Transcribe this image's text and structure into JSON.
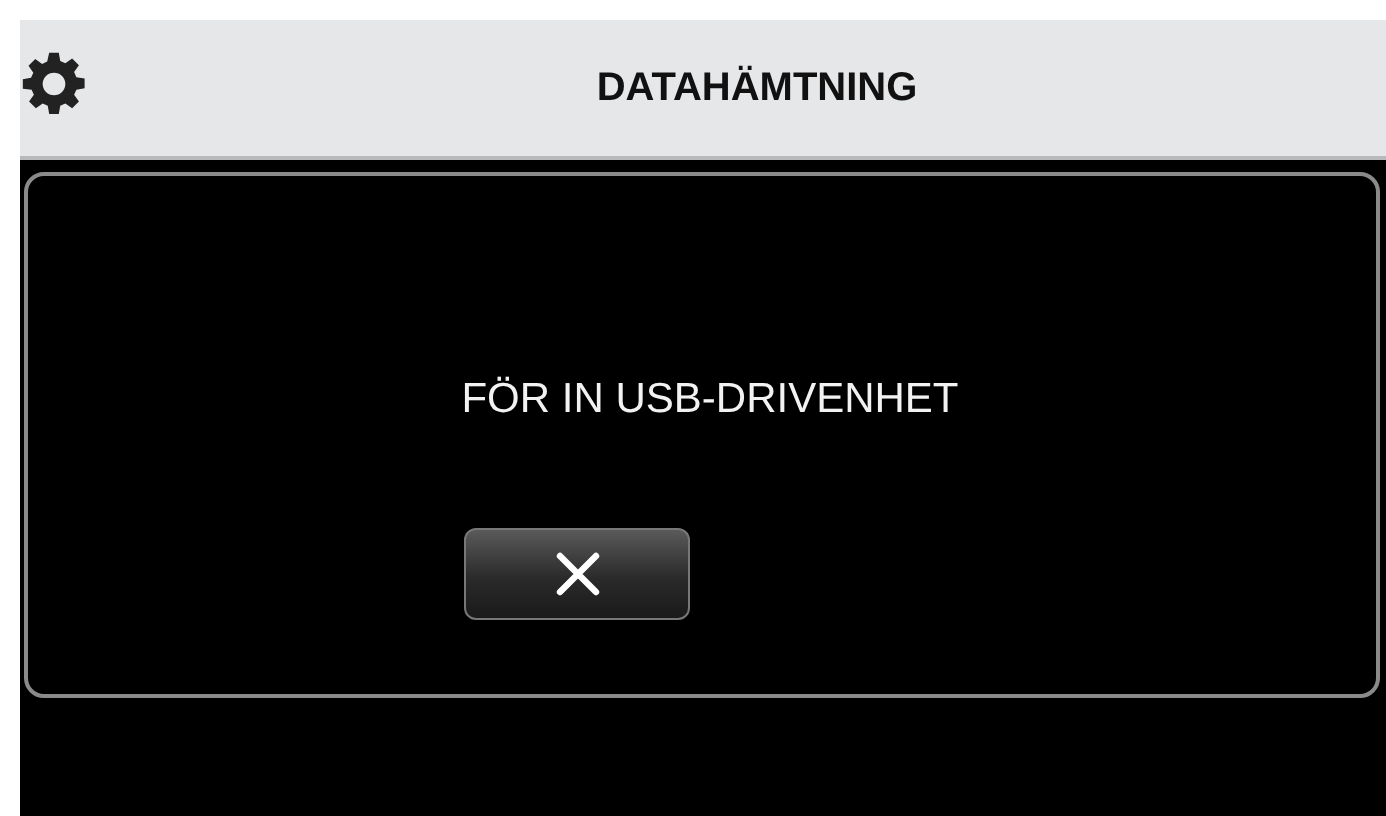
{
  "header": {
    "title": "DATAHÄMTNING"
  },
  "dialog": {
    "message": "FÖR IN USB-DRIVENHET"
  }
}
